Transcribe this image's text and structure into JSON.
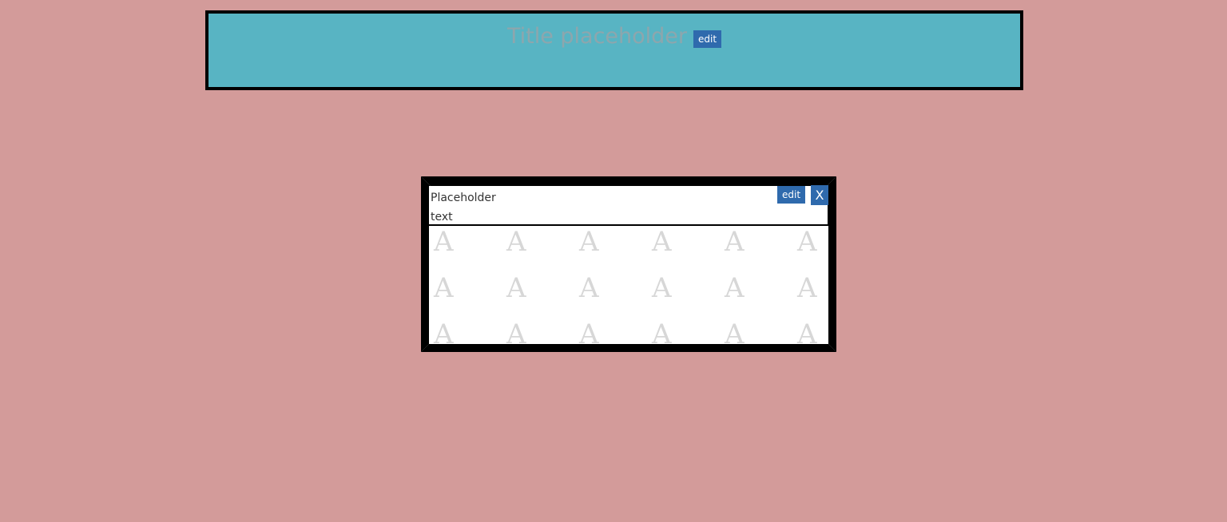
{
  "header": {
    "title": "Title placeholder",
    "edit_label": "edit"
  },
  "card": {
    "text": "Placeholder text",
    "edit_label": "edit",
    "close_label": "X",
    "pattern_glyph": "A",
    "pattern_rows": 3,
    "pattern_cols": 6
  },
  "colors": {
    "page_background": "#d39b9a",
    "header_background": "#58b4c3",
    "title_text": "#8da6ad",
    "button_background": "#2f6aad",
    "border": "#000000",
    "pattern_glyph": "#d7d7d7"
  }
}
